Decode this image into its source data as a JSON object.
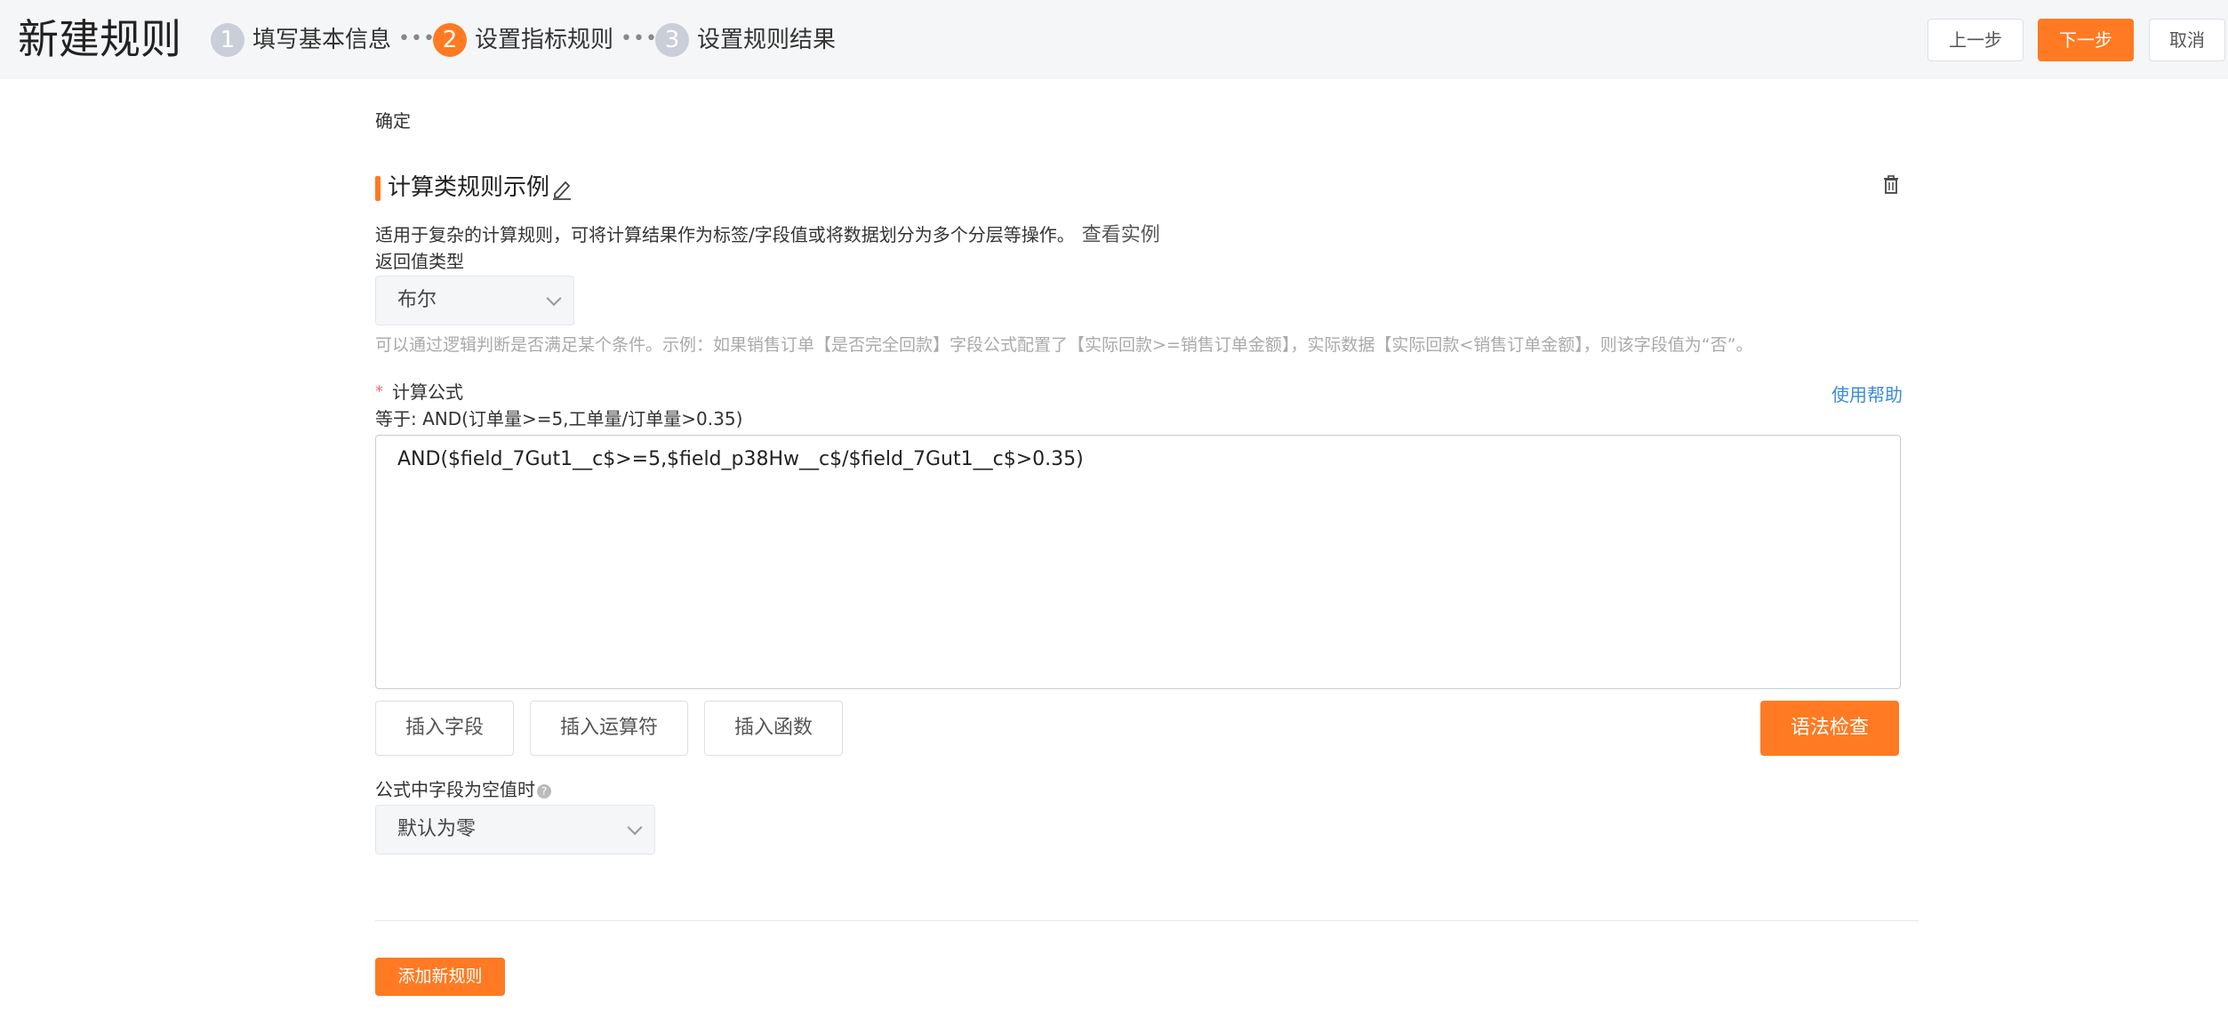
{
  "header": {
    "title": "新建规则",
    "steps": [
      {
        "number": "1",
        "label": "填写基本信息"
      },
      {
        "number": "2",
        "label": "设置指标规则"
      },
      {
        "number": "3",
        "label": "设置规则结果"
      }
    ],
    "separator": "•••",
    "prev_label": "上一步",
    "next_label": "下一步",
    "cancel_label": "取消"
  },
  "confirm_text": "确定",
  "rule": {
    "title": "计算类规则示例",
    "description": "适用于复杂的计算规则，可将计算结果作为标签/字段值或将数据划分为多个分层等操作。",
    "example_link": "查看实例",
    "return_type_label": "返回值类型",
    "return_type_value": "布尔",
    "hint": "可以通过逻辑判断是否满足某个条件。示例：如果销售订单【是否完全回款】字段公式配置了【实际回款>=销售订单金额】，实际数据【实际回款<销售订单金额】，则该字段值为“否”。",
    "formula_label": "计算公式",
    "required_mark": "*",
    "help_link": "使用帮助",
    "equals_text": "等于: AND(订单量>=5,工单量/订单量>0.35)",
    "formula_value": "AND($field_7Gut1__c$>=5,$field_p38Hw__c$/$field_7Gut1__c$>0.35)",
    "insert_field_label": "插入字段",
    "insert_operator_label": "插入运算符",
    "insert_function_label": "插入函数",
    "syntax_check_label": "语法检查",
    "null_label": "公式中字段为空值时",
    "null_help_icon": "?",
    "null_value": "默认为零"
  },
  "add_rule_label": "添加新规则",
  "colors": {
    "accent": "#ff7a22",
    "link": "#3b8bd9",
    "required": "#f56c6c"
  }
}
